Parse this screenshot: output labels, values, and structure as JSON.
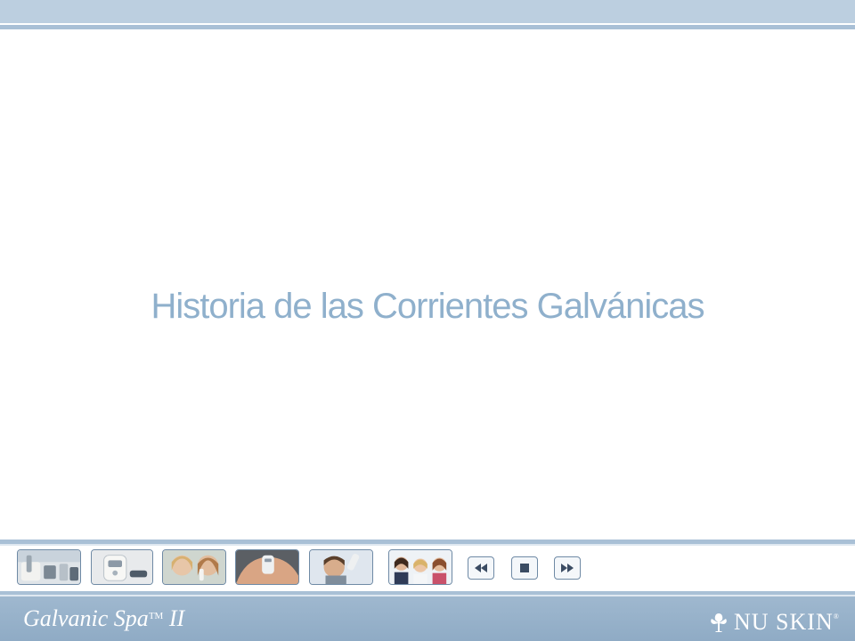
{
  "slide": {
    "title": "Historia de las Corrientes Galvánicas"
  },
  "footer": {
    "product_name": "Galvanic Spa",
    "product_tm": "TM",
    "product_suffix": " II",
    "brand_name": "NU SKIN",
    "brand_mark": "®"
  },
  "thumbnails": [
    {
      "name": "thumb-device-and-products",
      "subject": "spa device with products"
    },
    {
      "name": "thumb-handheld-device",
      "subject": "handheld galvanic device"
    },
    {
      "name": "thumb-women-facial",
      "subject": "woman using device on face"
    },
    {
      "name": "thumb-shoulder-treatment",
      "subject": "device applied to shoulder"
    },
    {
      "name": "thumb-man-hair",
      "subject": "man using device on hair"
    },
    {
      "name": "thumb-three-women",
      "subject": "three smiling women"
    }
  ],
  "navigation": {
    "previous_icon": "rewind-icon",
    "stop_icon": "stop-icon",
    "next_icon": "fast-forward-icon"
  },
  "colors": {
    "title": "#8fb0cc",
    "band": "#bccfe0",
    "rule": "#a9c0d6",
    "footer": "#9fb8cf",
    "button_border": "#6f8aa5"
  }
}
